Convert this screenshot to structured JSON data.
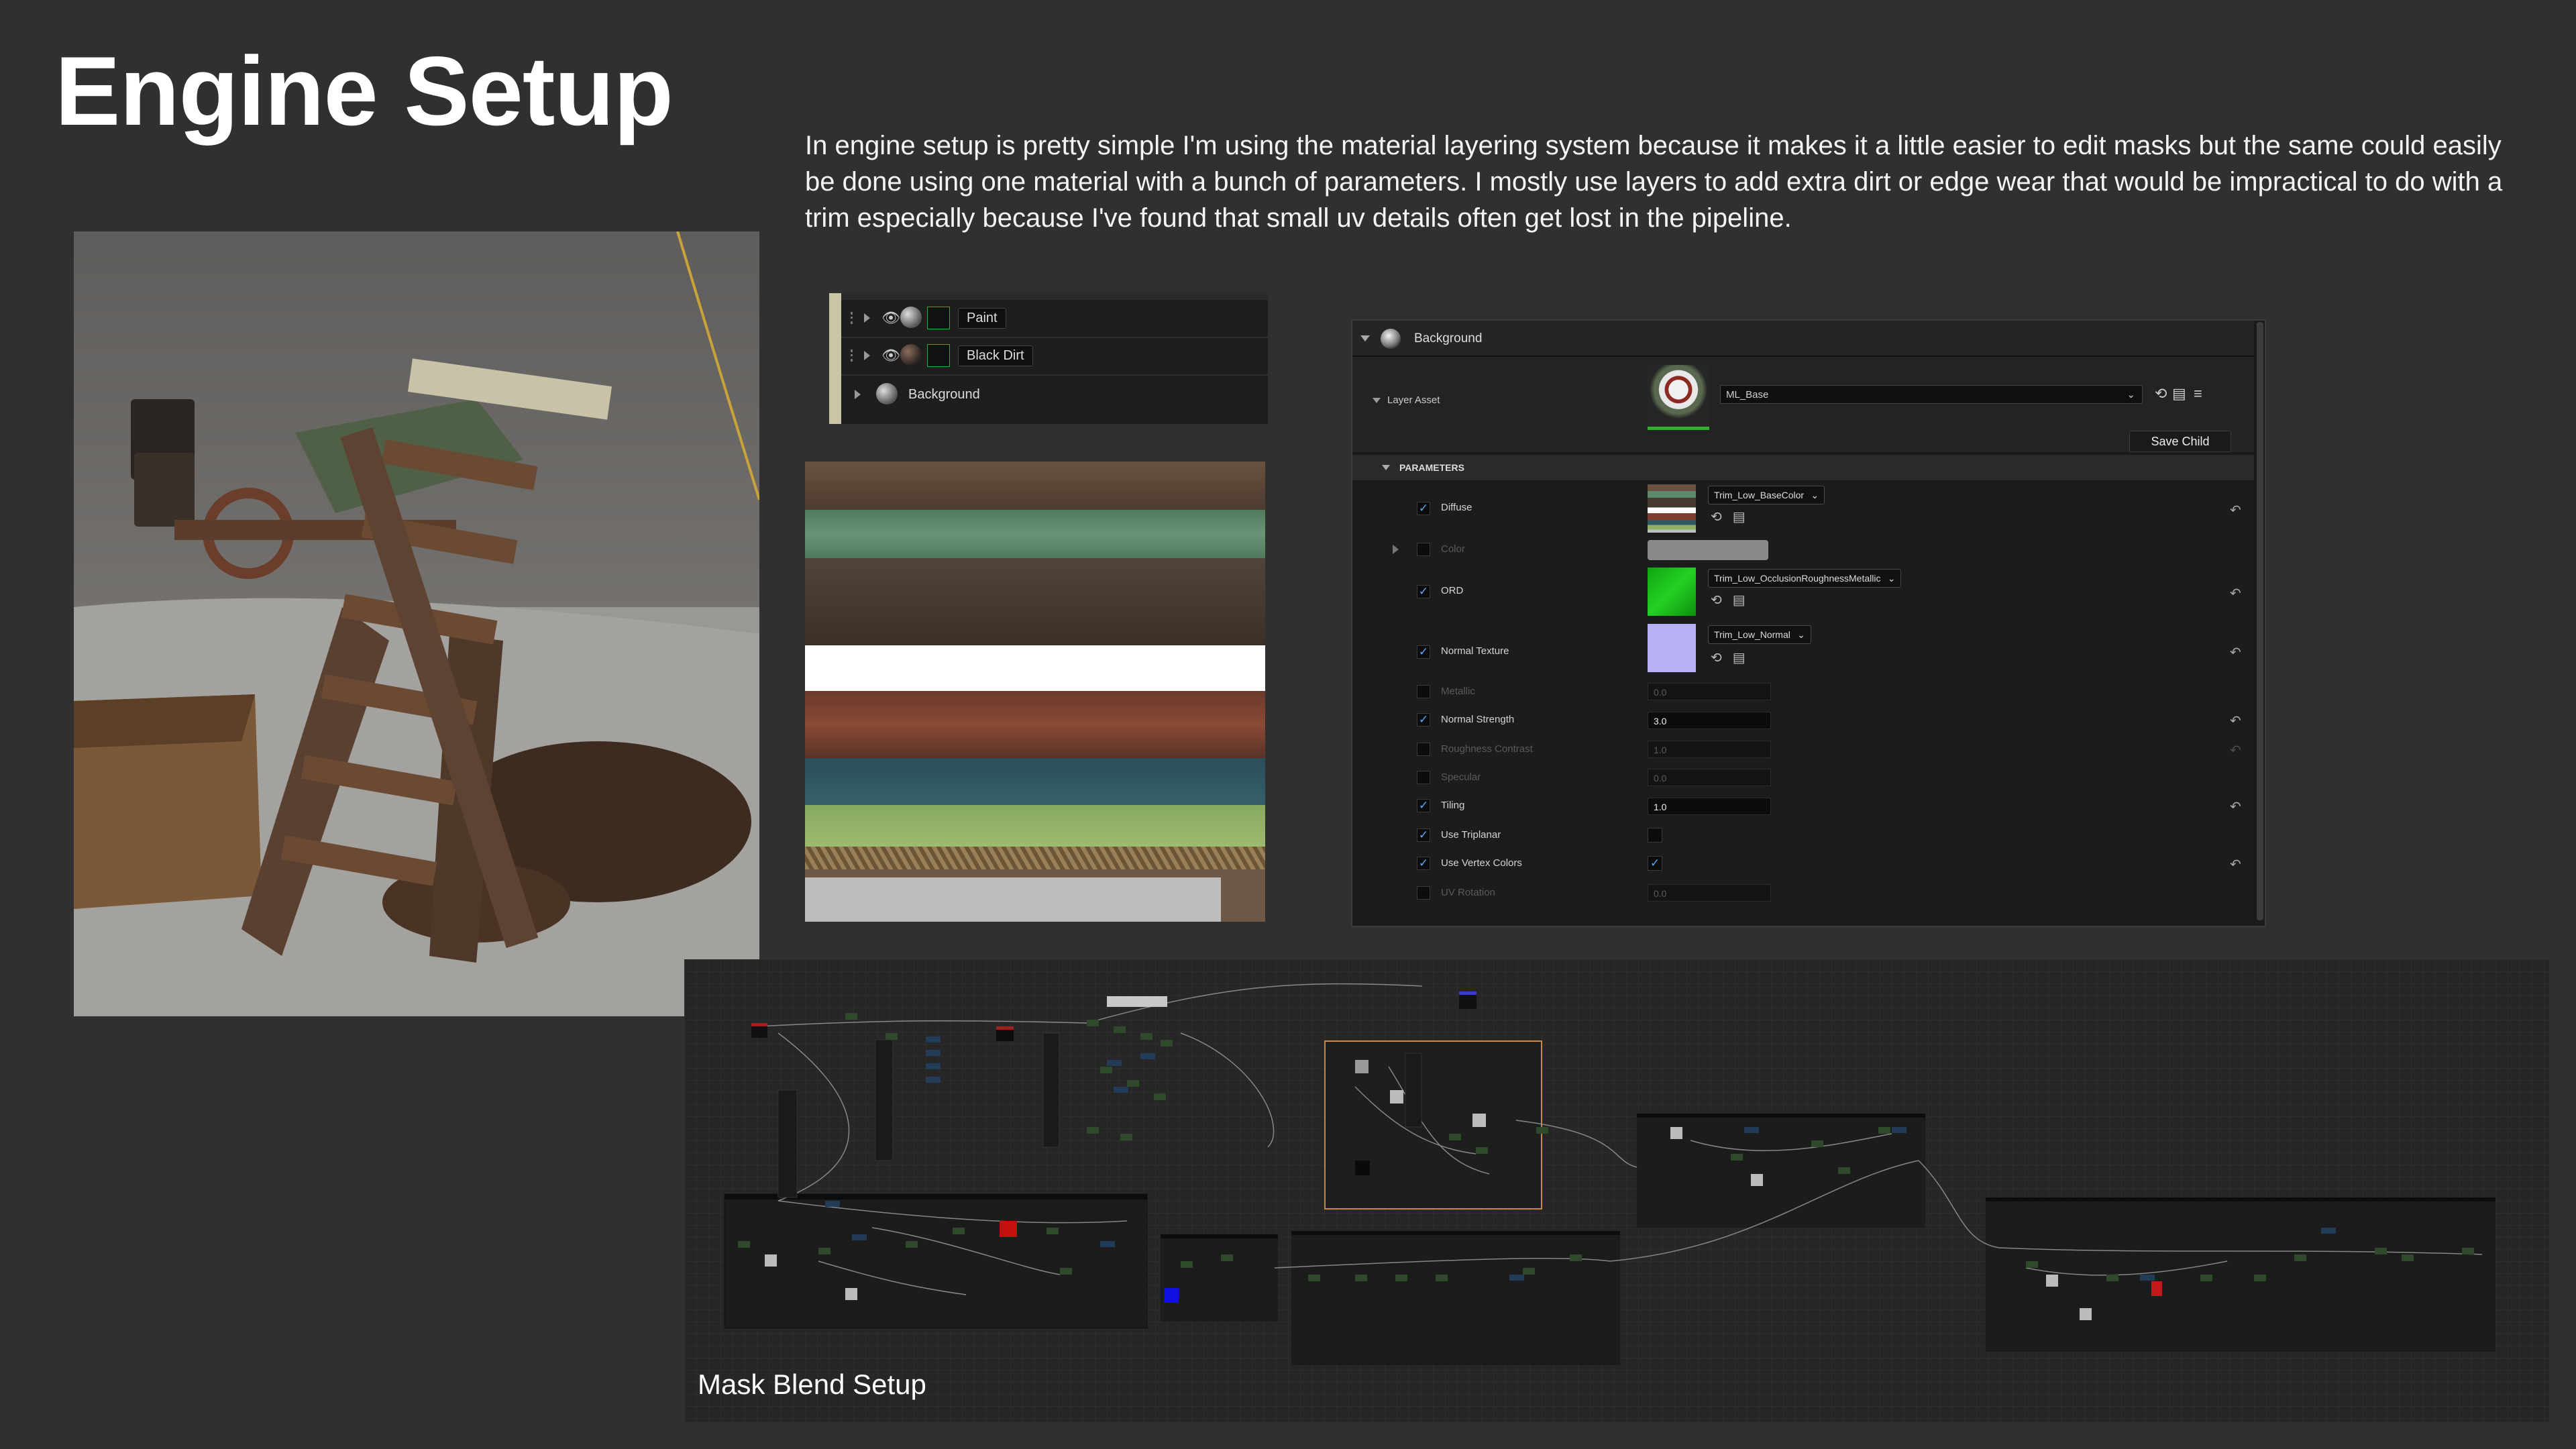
{
  "page": {
    "title": "Engine Setup",
    "description": "In engine setup is pretty simple I'm using the material layering system because it makes it a little easier to edit masks but the same could easily be done using one material with a bunch of parameters. I mostly use layers to add extra dirt or edge wear that would be impractical to do with a trim especially because I've found that small uv details often get lost in the pipeline.",
    "graph_caption": "Mask Blend Setup"
  },
  "layer_stack": {
    "rows": [
      {
        "label": "Paint",
        "icons": [
          "drag-handle-icon",
          "expand-arrow-icon",
          "visibility-eye-icon",
          "material-sphere-icon",
          "mask-icon"
        ]
      },
      {
        "label": "Black Dirt",
        "icons": [
          "drag-handle-icon",
          "expand-arrow-icon",
          "visibility-eye-icon",
          "material-sphere-icon",
          "mask-icon"
        ]
      },
      {
        "label": "Background",
        "icons": [
          "expand-arrow-icon",
          "material-sphere-icon"
        ]
      }
    ]
  },
  "trim_texture": {
    "bands": [
      "#5e4a3a",
      "#5d8a6a",
      "#453a30",
      "#ffffff",
      "#7a3f2e",
      "#2f5864",
      "#8fb066",
      "#8c7650",
      "#bdbdbd"
    ]
  },
  "details": {
    "header": "Background",
    "layer_asset_label": "Layer Asset",
    "layer_asset_value": "ML_Base",
    "save_child": "Save Child",
    "section": "PARAMETERS",
    "params": [
      {
        "name": "Diffuse",
        "checked": true,
        "texture": "Trim_Low_BaseColor"
      },
      {
        "name": "Color",
        "checked": false
      },
      {
        "name": "ORD",
        "checked": true,
        "texture": "Trim_Low_OcclusionRoughnessMetallic"
      },
      {
        "name": "Normal Texture",
        "checked": true,
        "texture": "Trim_Low_Normal"
      },
      {
        "name": "Metallic",
        "checked": false,
        "value": "0.0"
      },
      {
        "name": "Normal Strength",
        "checked": true,
        "value": "3.0"
      },
      {
        "name": "Roughness Contrast",
        "checked": false,
        "value": "1.0"
      },
      {
        "name": "Specular",
        "checked": false,
        "value": "0.0"
      },
      {
        "name": "Tiling",
        "checked": true,
        "value": "1.0"
      },
      {
        "name": "Use Triplanar",
        "checked": true,
        "bool": false
      },
      {
        "name": "Use Vertex Colors",
        "checked": true,
        "bool": true
      },
      {
        "name": "UV Rotation",
        "checked": false,
        "value": "0.0"
      }
    ]
  },
  "colors": {
    "page_bg": "#303030",
    "accent_blue": "#5aaaff",
    "ord_green": "#18b818",
    "normal_purple": "#b8b0f6",
    "comment_orange": "#c88a3a"
  }
}
